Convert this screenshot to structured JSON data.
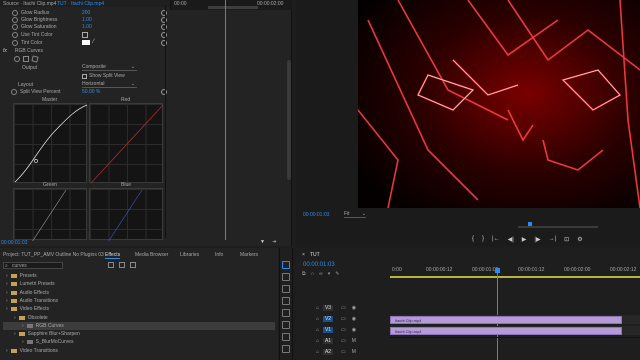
{
  "effect_controls": {
    "source_label": "Source · Itachi Clip.mp4",
    "sequence_label": "TUT · Itachi Clip.mp4",
    "ruler_start": "00:00",
    "ruler_end": "00:00:02:00",
    "glow_radius": {
      "label": "Glow Radius",
      "value": "200"
    },
    "glow_brightness": {
      "label": "Glow Brightness",
      "value": "1.00"
    },
    "glow_saturation": {
      "label": "Glow Saturation",
      "value": "1.00"
    },
    "use_tint_color": {
      "label": "Use Tint Color"
    },
    "tint_color": {
      "label": "Tint Color"
    },
    "fx_name": "RGB Curves",
    "output": {
      "label": "Output",
      "value": "Composite"
    },
    "show_split_view": "Show Split View",
    "layout": {
      "label": "Layout",
      "value": "Horizontal"
    },
    "split_view_percent": {
      "label": "Split View Percent",
      "value": "50.00 %"
    },
    "curves": {
      "master": "Master",
      "red": "Red",
      "green": "Green",
      "blue": "Blue"
    },
    "timecode": "00:00:01:03"
  },
  "program_monitor": {
    "timecode": "00:00:01:03",
    "fit": "Fit",
    "buttons": [
      "{",
      "}",
      "|←",
      "◀|",
      "▶",
      "|▶",
      "→|"
    ]
  },
  "project": {
    "title": "Project: TUT_PP_AMV Outline No Plugins 03",
    "tabs": [
      "Effects",
      "Media Browser",
      "Libraries",
      "Info",
      "Markers"
    ],
    "search_value": "curves",
    "tree": [
      {
        "label": "Presets",
        "depth": 0,
        "selected": false
      },
      {
        "label": "Lumetri Presets",
        "depth": 0,
        "selected": false
      },
      {
        "label": "Audio Effects",
        "depth": 0,
        "selected": false
      },
      {
        "label": "Audio Transitions",
        "depth": 0,
        "selected": false
      },
      {
        "label": "Video Effects",
        "depth": 0,
        "selected": false
      },
      {
        "label": "Obsolete",
        "depth": 1,
        "selected": false
      },
      {
        "label": "RGB Curves",
        "depth": 2,
        "selected": true
      },
      {
        "label": "Sapphire Blur+Sharpen",
        "depth": 1,
        "selected": false
      },
      {
        "label": "S_BlurMoCurves",
        "depth": 2,
        "selected": false
      },
      {
        "label": "Video Transitions",
        "depth": 0,
        "selected": false
      }
    ]
  },
  "timeline": {
    "sequence_name": "TUT",
    "timecode": "00:00:01:03",
    "ruler": [
      "0:00",
      "00:00:00:12",
      "00:00:01:00",
      "00:00:01:12",
      "00:00:02:00",
      "00:00:02:12"
    ],
    "tracks": [
      "V3",
      "V2",
      "V1",
      "A1",
      "A2"
    ],
    "clip_v2": "Itachi Clip.mp4",
    "clip_v1": "Itachi Clip.mp4"
  }
}
